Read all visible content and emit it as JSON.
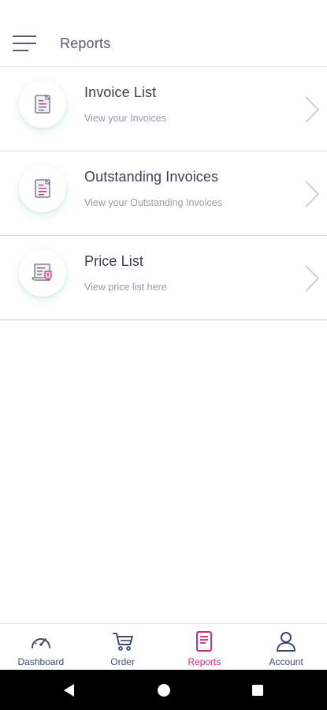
{
  "app_bar": {
    "title": "Reports",
    "menu_icon": "hamburger-menu-icon"
  },
  "reports": [
    {
      "title": "Invoice List",
      "subtitle": "View your Invoices",
      "icon": "invoice-document-icon"
    },
    {
      "title": "Outstanding Invoices",
      "subtitle": "View your Outstanding Invoices",
      "icon": "outstanding-invoice-icon"
    },
    {
      "title": "Price List",
      "subtitle": "View price list here",
      "icon": "price-list-scroll-icon"
    }
  ],
  "bottom_nav": {
    "items": [
      {
        "label": "Dashboard",
        "icon": "speedometer-icon"
      },
      {
        "label": "Order",
        "icon": "cart-icon"
      },
      {
        "label": "Reports",
        "icon": "report-icon",
        "active": true
      },
      {
        "label": "Account",
        "icon": "user-icon"
      }
    ],
    "active_color": "#d6287c",
    "inactive_color": "#3f4a6e"
  },
  "colors": {
    "accent": "#d6287c",
    "text": "#3e3e50",
    "subtext": "#9a9aa8"
  }
}
